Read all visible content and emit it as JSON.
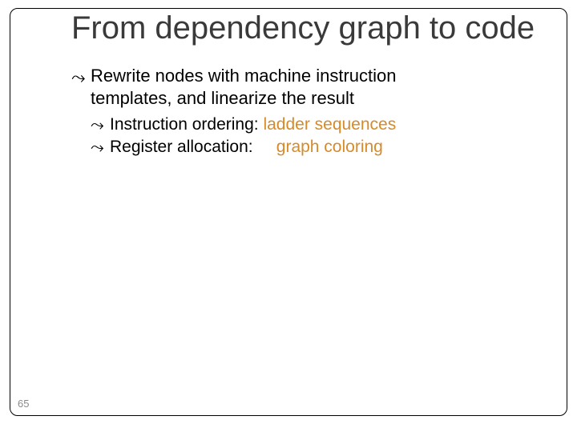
{
  "title": "From dependency graph to code",
  "bullet1_line1": "Rewrite nodes with machine instruction",
  "bullet1_line2": "templates, and linearize the result",
  "sub1_pre": "Instruction ordering: ",
  "sub1_hl": "ladder sequences",
  "sub2_pre": "Register allocation:     ",
  "sub2_hl": "graph coloring",
  "page_number": "65",
  "marker": "⤳"
}
